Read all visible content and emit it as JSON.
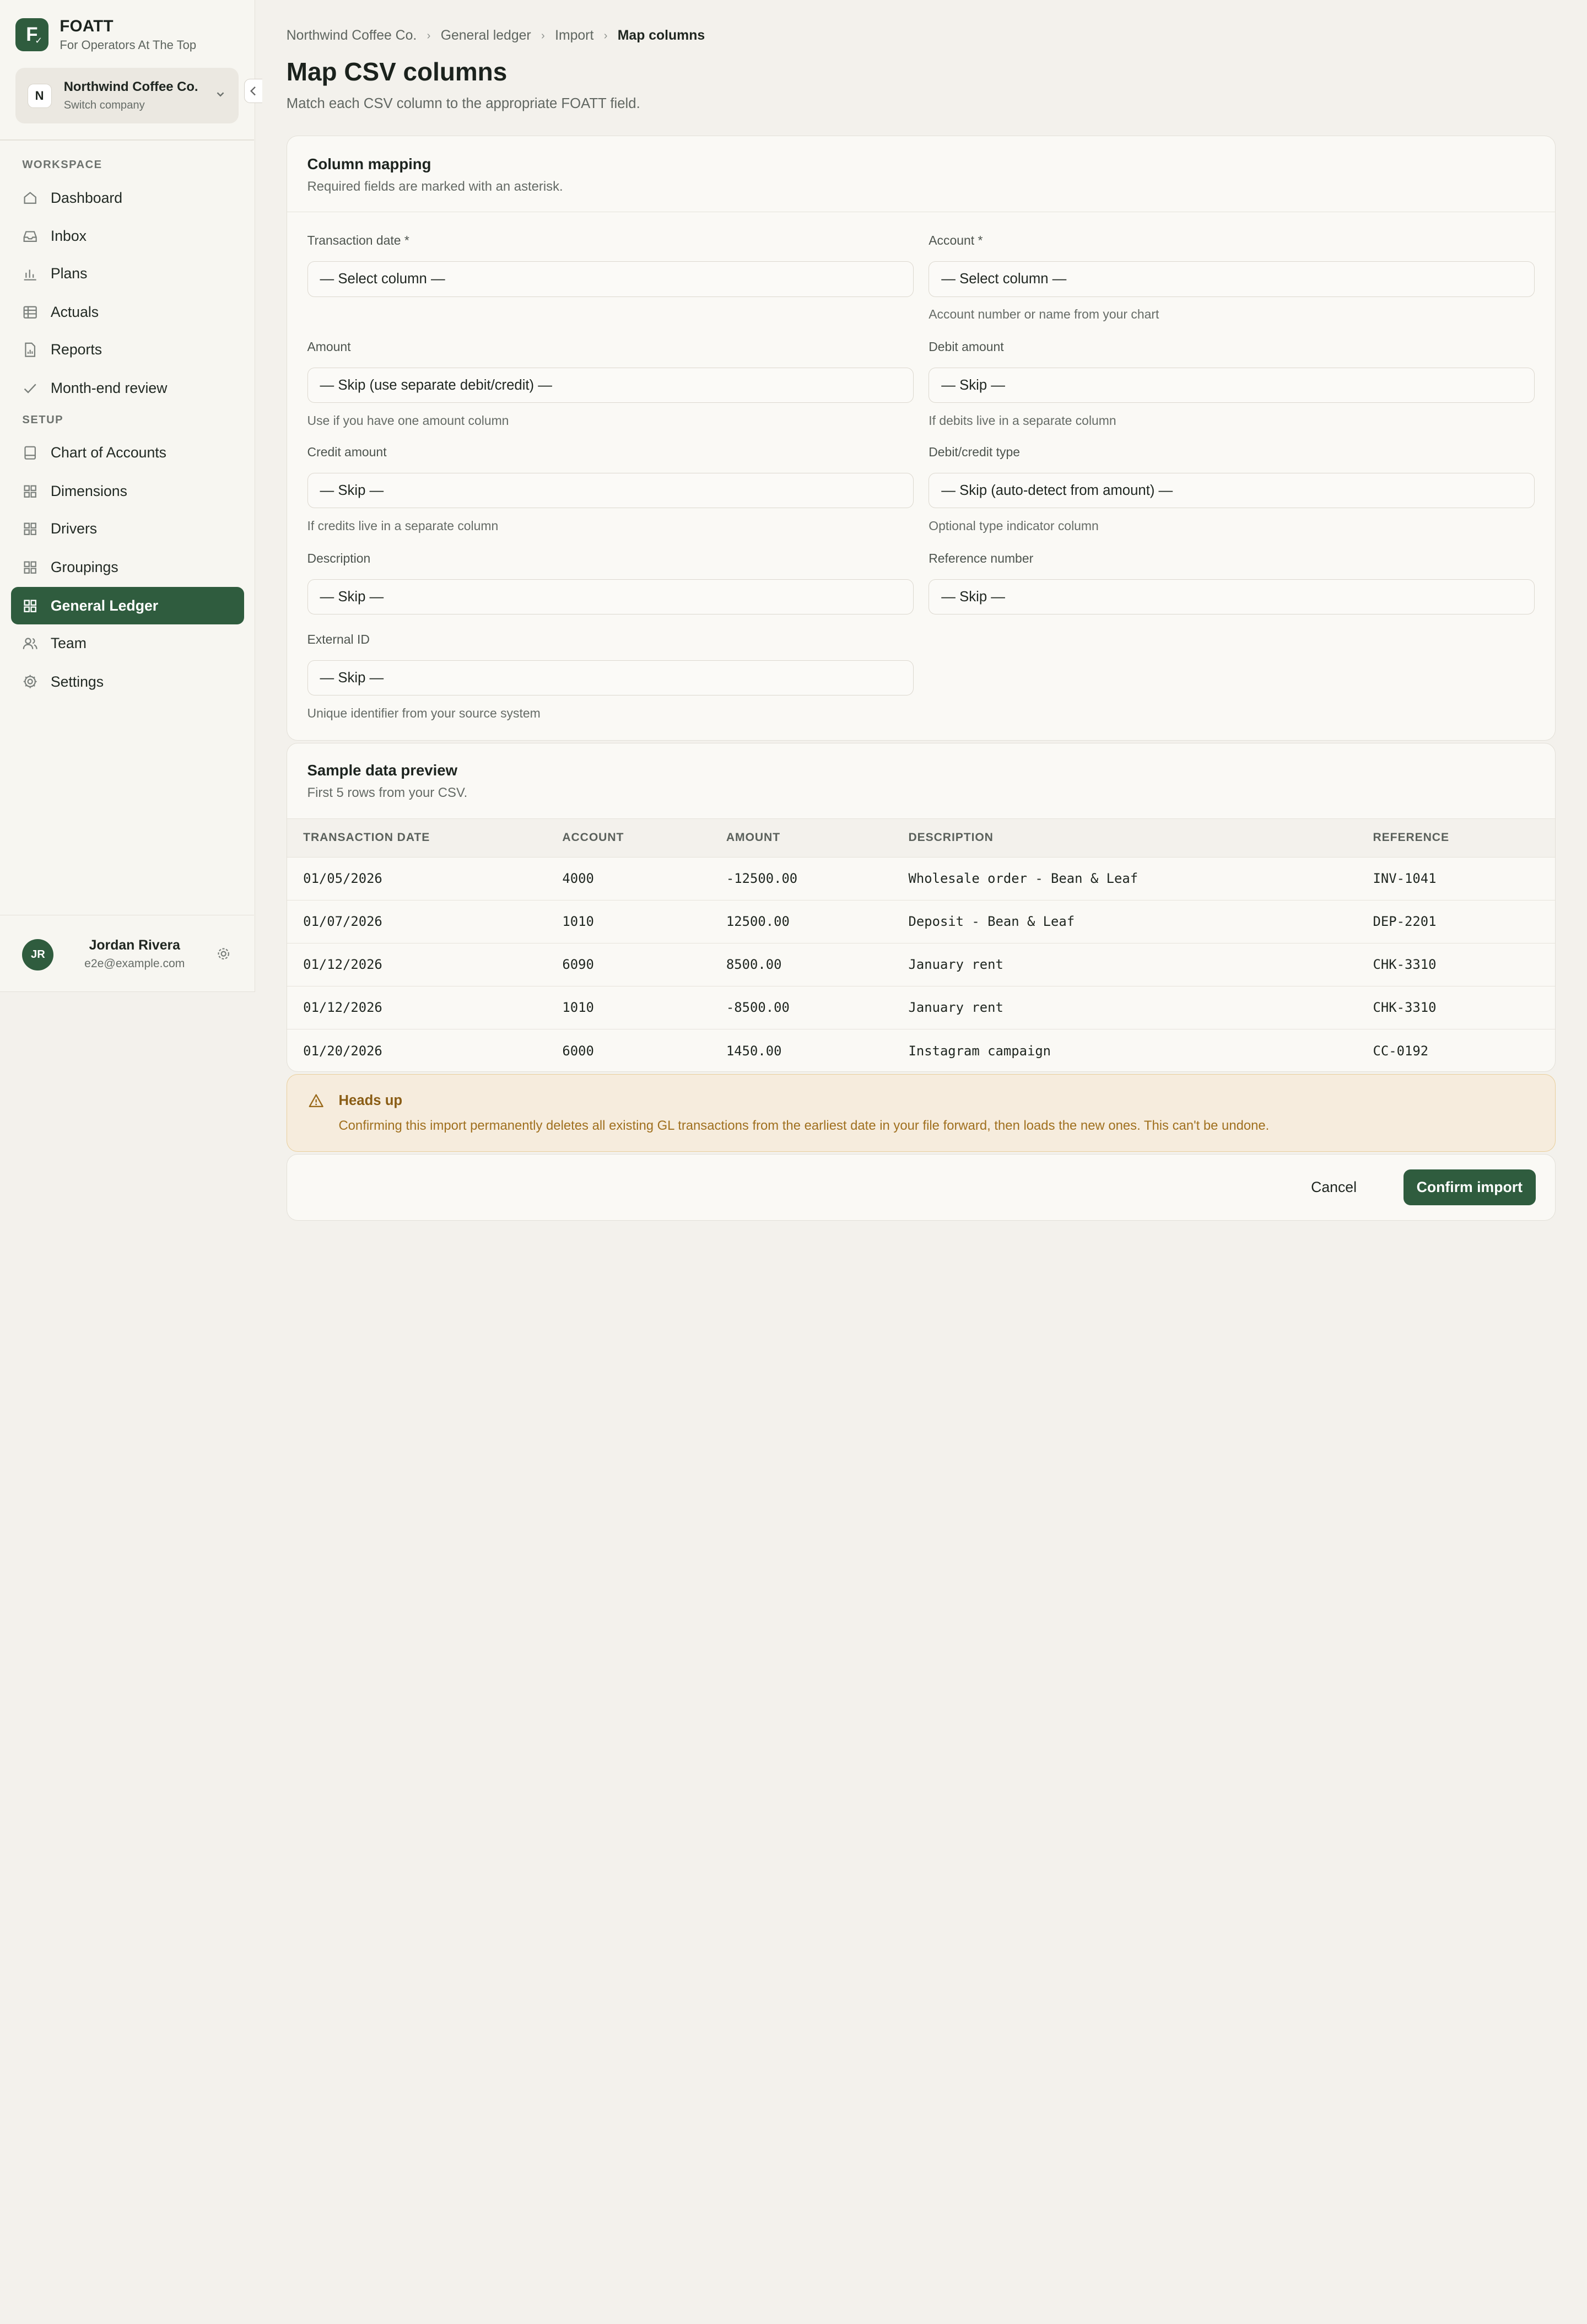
{
  "brand": {
    "name": "FOATT",
    "tagline": "For Operators At The Top",
    "logo_letter": "F"
  },
  "company": {
    "badge": "N",
    "name": "Northwind Coffee Co.",
    "sub": "Switch company"
  },
  "sidebar": {
    "workspace_label": "WORKSPACE",
    "setup_label": "SETUP",
    "workspace_items": [
      {
        "label": "Dashboard",
        "icon": "home-icon"
      },
      {
        "label": "Inbox",
        "icon": "inbox-icon"
      },
      {
        "label": "Plans",
        "icon": "bar-chart-icon"
      },
      {
        "label": "Actuals",
        "icon": "table-icon"
      },
      {
        "label": "Reports",
        "icon": "report-icon"
      },
      {
        "label": "Month-end review",
        "icon": "check-icon"
      }
    ],
    "setup_items": [
      {
        "label": "Chart of Accounts",
        "icon": "book-icon"
      },
      {
        "label": "Dimensions",
        "icon": "grid-icon"
      },
      {
        "label": "Drivers",
        "icon": "grid-icon"
      },
      {
        "label": "Groupings",
        "icon": "grid-icon"
      },
      {
        "label": "General Ledger",
        "icon": "grid-icon",
        "active": true
      },
      {
        "label": "Team",
        "icon": "users-icon"
      },
      {
        "label": "Settings",
        "icon": "gear-icon"
      }
    ]
  },
  "user": {
    "initials": "JR",
    "name": "Jordan Rivera",
    "email": "e2e@example.com"
  },
  "breadcrumb": [
    "Northwind Coffee Co.",
    "General ledger",
    "Import",
    "Map columns"
  ],
  "page": {
    "title": "Map CSV columns",
    "subtitle": "Match each CSV column to the appropriate FOATT field."
  },
  "mapping": {
    "title": "Column mapping",
    "subtitle": "Required fields are marked with an asterisk.",
    "fields": [
      {
        "label": "Transaction date *",
        "value": "— Select column —",
        "hint": ""
      },
      {
        "label": "Account *",
        "value": "— Select column —",
        "hint": "Account number or name from your chart"
      },
      {
        "label": "Amount",
        "value": "— Skip (use separate debit/credit) —",
        "hint": "Use if you have one amount column"
      },
      {
        "label": "Debit amount",
        "value": "— Skip —",
        "hint": "If debits live in a separate column"
      },
      {
        "label": "Credit amount",
        "value": "— Skip —",
        "hint": "If credits live in a separate column"
      },
      {
        "label": "Debit/credit type",
        "value": "— Skip (auto-detect from amount) —",
        "hint": "Optional type indicator column"
      },
      {
        "label": "Description",
        "value": "— Skip —",
        "hint": ""
      },
      {
        "label": "Reference number",
        "value": "— Skip —",
        "hint": ""
      },
      {
        "label": "External ID",
        "value": "— Skip —",
        "hint": "Unique identifier from your source system"
      }
    ]
  },
  "preview": {
    "title": "Sample data preview",
    "subtitle": "First 5 rows from your CSV.",
    "columns": [
      "TRANSACTION DATE",
      "ACCOUNT",
      "AMOUNT",
      "DESCRIPTION",
      "REFERENCE"
    ],
    "rows": [
      [
        "01/05/2026",
        "4000",
        "-12500.00",
        "Wholesale order - Bean & Leaf",
        "INV-1041"
      ],
      [
        "01/07/2026",
        "1010",
        "12500.00",
        "Deposit - Bean & Leaf",
        "DEP-2201"
      ],
      [
        "01/12/2026",
        "6090",
        "8500.00",
        "January rent",
        "CHK-3310"
      ],
      [
        "01/12/2026",
        "1010",
        "-8500.00",
        "January rent",
        "CHK-3310"
      ],
      [
        "01/20/2026",
        "6000",
        "1450.00",
        "Instagram campaign",
        "CC-0192"
      ]
    ]
  },
  "alert": {
    "title": "Heads up",
    "text": "Confirming this import permanently deletes all existing GL transactions from the earliest date in your file forward, then loads the new ones. This can't be undone."
  },
  "actions": {
    "cancel": "Cancel",
    "confirm": "Confirm import"
  },
  "colors": {
    "accent": "#2f5c3e",
    "warning_bg": "#f6ecdd",
    "warning_text": "#8a5d15"
  }
}
